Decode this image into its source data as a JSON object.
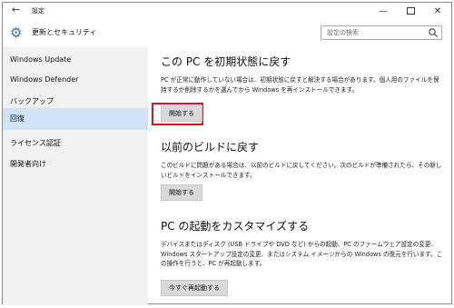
{
  "window": {
    "back_glyph": "←",
    "title": "設定",
    "minimize_glyph": "—",
    "close_glyph": "✕"
  },
  "header": {
    "title": "更新とセキュリティ",
    "search_placeholder": "設定の検索"
  },
  "sidebar": {
    "items": [
      {
        "label": "Windows Update"
      },
      {
        "label": "Windows Defender"
      },
      {
        "label": "バックアップ"
      },
      {
        "label": "回復"
      },
      {
        "label": "ライセンス認証"
      },
      {
        "label": "開発者向け"
      }
    ]
  },
  "sections": {
    "reset": {
      "title": "この PC を初期状態に戻す",
      "description": "PC が正常に動作していない場合は、初期状態に戻すと解決する場合があります。個人用のファイルを保持するか削除するかを選んでから Windows を再インストールできます。",
      "button": "開始する"
    },
    "previous_build": {
      "title": "以前のビルドに戻す",
      "description": "このビルドに問題がある場合は、以前のビルドに戻してください。次のビルドが準備されたら、その新しいビルドをインストールできます。",
      "button": "開始する"
    },
    "advanced_startup": {
      "title": "PC の起動をカスタマイズする",
      "description": "デバイスまたはディスク (USB ドライブや DVD など) からの起動、PC のファームウェア設定の変更、Windows スタートアップ設定の変更、またはシステム イメージからの Windows の復元を行います。この操作を行うと、PC が再起動します。",
      "button": "今すぐ再起動する"
    }
  },
  "colors": {
    "accent": "#3b6fb6",
    "sidebar_bg": "#f2f2f2",
    "active_item_bg": "#cfe3f4",
    "highlight_box": "#d9151b"
  }
}
